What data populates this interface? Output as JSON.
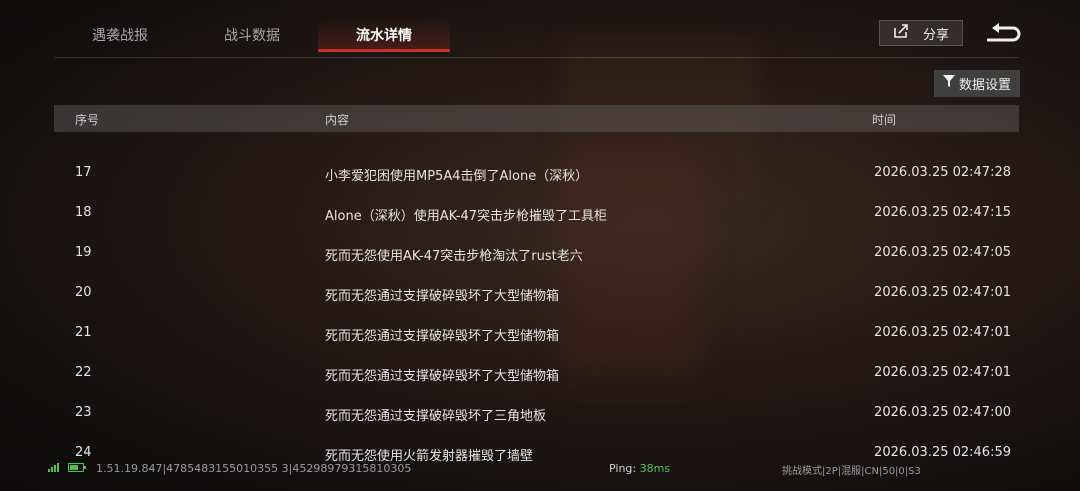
{
  "tabs": [
    {
      "label": "遇袭战报",
      "active": false
    },
    {
      "label": "战斗数据",
      "active": false
    },
    {
      "label": "流水详情",
      "active": true
    }
  ],
  "header": {
    "share_label": "分享",
    "share_icon": "share-icon",
    "back_icon": "back-arrow-icon"
  },
  "filter": {
    "label": "数据设置",
    "icon": "filter-icon"
  },
  "table": {
    "columns": {
      "index": "序号",
      "content": "内容",
      "time": "时间"
    },
    "rows": [
      {
        "index": "17",
        "content": "小李爱犯困使用MP5A4击倒了Alone（深秋）",
        "time": "2026.03.25 02:47:28"
      },
      {
        "index": "18",
        "content": "Alone（深秋）使用AK-47突击步枪摧毁了工具柜",
        "time": "2026.03.25 02:47:15"
      },
      {
        "index": "19",
        "content": "死而无怨使用AK-47突击步枪淘汰了rust老六",
        "time": "2026.03.25 02:47:05"
      },
      {
        "index": "20",
        "content": "死而无怨通过支撑破碎毁坏了大型储物箱",
        "time": "2026.03.25 02:47:01"
      },
      {
        "index": "21",
        "content": "死而无怨通过支撑破碎毁坏了大型储物箱",
        "time": "2026.03.25 02:47:01"
      },
      {
        "index": "22",
        "content": "死而无怨通过支撑破碎毁坏了大型储物箱",
        "time": "2026.03.25 02:47:01"
      },
      {
        "index": "23",
        "content": "死而无怨通过支撑破碎毁坏了三角地板",
        "time": "2026.03.25 02:47:00"
      },
      {
        "index": "24",
        "content": "死而无怨使用火箭发射器摧毁了墙壁",
        "time": "2026.03.25 02:46:59"
      }
    ]
  },
  "status": {
    "build": "1.51.19.847|4785483155010355 3|45298979315810305",
    "ping_label": "Ping: ",
    "ping_value": "38ms",
    "mode": "挑战模式|2P|混服|CN|50|0|S3",
    "colors": {
      "ok": "#4cc24c",
      "accent": "#c8332a"
    }
  }
}
